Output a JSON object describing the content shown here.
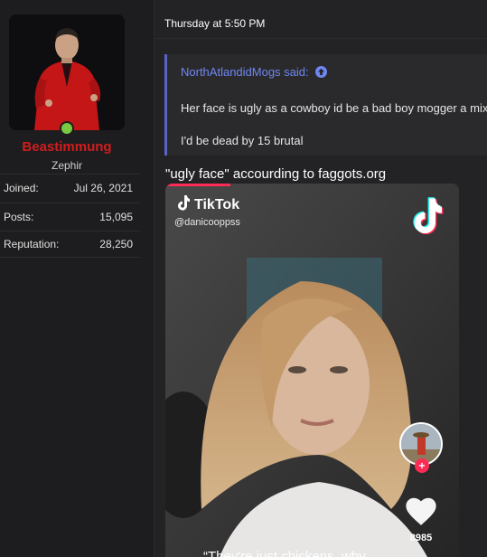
{
  "user": {
    "name": "Beastimmung",
    "title": "Zephir",
    "stats": [
      {
        "label": "Joined:",
        "value": "Jul 26, 2021"
      },
      {
        "label": "Posts:",
        "value": "15,095"
      },
      {
        "label": "Reputation:",
        "value": "28,250"
      }
    ]
  },
  "post": {
    "date": "Thursday at 5:50 PM",
    "quote": {
      "author": "NorthAtlandidMogs said:",
      "line1": "Her face is ugly as a cowboy id be a bad boy mogger a mix",
      "line2": "I'd be dead by 15 brutal"
    },
    "text": "\"ugly face\" accourding to faggots.org",
    "tiktok": {
      "brand": "TikTok",
      "handle": "@danicooppss",
      "likes": "8985",
      "caption": "“They're just chickens, why"
    }
  },
  "colors": {
    "username": "#d11d1d",
    "online": "#7ac943",
    "quote_accent": "#6f87f0",
    "tiktok_red": "#fe2c55",
    "tiktok_cyan": "#25f4ee"
  }
}
